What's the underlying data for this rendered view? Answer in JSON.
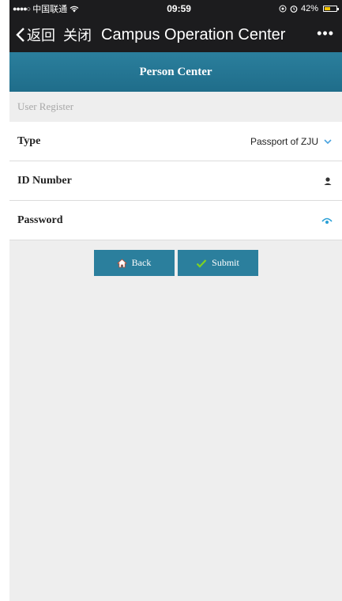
{
  "status_bar": {
    "carrier": "中国联通",
    "time": "09:59",
    "battery": "42%"
  },
  "nav": {
    "back_label": "返回",
    "close_label": "关闭",
    "title": "Campus Operation Center",
    "more": "•••"
  },
  "header": {
    "title": "Person Center"
  },
  "section": {
    "label": "User Register"
  },
  "form": {
    "type": {
      "label": "Type",
      "value": "Passport of ZJU"
    },
    "id_number": {
      "label": "ID Number"
    },
    "password": {
      "label": "Password"
    }
  },
  "buttons": {
    "back": "Back",
    "submit": "Submit"
  },
  "colors": {
    "accent": "#2b7f9d",
    "chevron": "#4aa3df",
    "eye": "#2a9fd6",
    "check": "#7ed321"
  }
}
